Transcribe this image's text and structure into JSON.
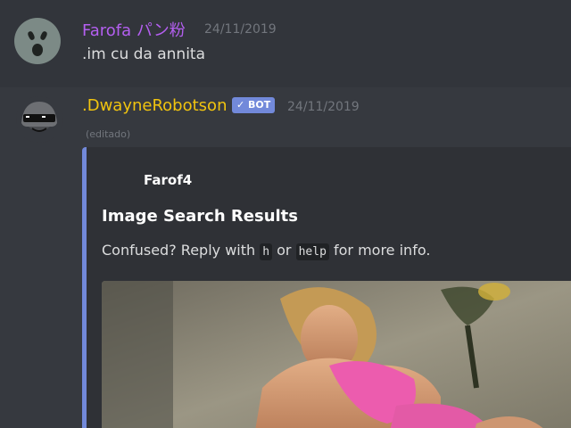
{
  "messages": [
    {
      "author": "Farofa パン粉",
      "timestamp": "24/11/2019",
      "content": ".im cu da annita",
      "name_color": "#b45ff0"
    },
    {
      "author": ".DwayneRobotson",
      "badge": "✓ BOT",
      "timestamp": "24/11/2019",
      "edited": "(editado)",
      "name_color": "#f1c40f",
      "embed": {
        "author": "Farof4",
        "title": "Image Search Results",
        "description_prefix": "Confused? Reply with ",
        "code1": "h",
        "description_mid": " or ",
        "code2": "help",
        "description_suffix": " for more info.",
        "accent_color": "#7289da"
      }
    }
  ],
  "icons": {
    "avatar1": "surprised-face-avatar",
    "avatar2": "sunglasses-robot-avatar"
  }
}
